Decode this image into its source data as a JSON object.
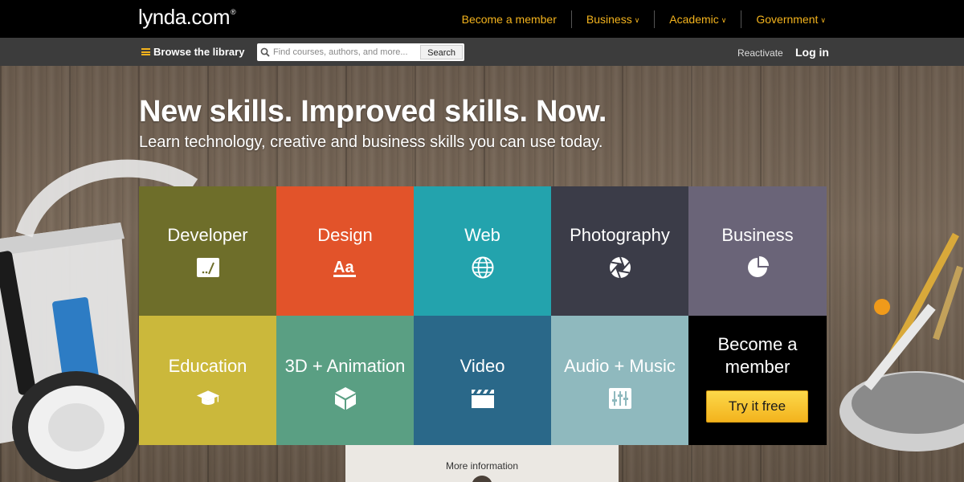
{
  "header": {
    "logo_text": "lynda.com",
    "logo_mark": "®",
    "nav": [
      {
        "label": "Become a member",
        "has_dropdown": false
      },
      {
        "label": "Business",
        "has_dropdown": true
      },
      {
        "label": "Academic",
        "has_dropdown": true
      },
      {
        "label": "Government",
        "has_dropdown": true
      }
    ],
    "accent_color": "#f3b31d"
  },
  "subnav": {
    "browse_label": "Browse the library",
    "search": {
      "placeholder": "Find courses, authors, and more...",
      "value": "",
      "button_label": "Search"
    },
    "reactivate_label": "Reactivate",
    "login_label": "Log in"
  },
  "hero": {
    "headline": "New skills. Improved skills. Now.",
    "subheadline": "Learn technology, creative and business skills you can use today."
  },
  "tiles": [
    {
      "label": "Developer",
      "icon": "code-editor-icon",
      "color": "#6e6e2a"
    },
    {
      "label": "Design",
      "icon": "typography-icon",
      "color": "#e2532a"
    },
    {
      "label": "Web",
      "icon": "globe-icon",
      "color": "#23a3ad"
    },
    {
      "label": "Photography",
      "icon": "aperture-icon",
      "color": "#3b3c48"
    },
    {
      "label": "Business",
      "icon": "pie-chart-icon",
      "color": "#6a6478"
    },
    {
      "label": "Education",
      "icon": "graduation-cap-icon",
      "color": "#cbb83b"
    },
    {
      "label": "3D + Animation",
      "icon": "cube-icon",
      "color": "#5a9f83"
    },
    {
      "label": "Video",
      "icon": "clapperboard-icon",
      "color": "#2a6889"
    },
    {
      "label": "Audio + Music",
      "icon": "mixer-sliders-icon",
      "color": "#8fb9be"
    }
  ],
  "member_tile": {
    "title": "Become a member",
    "cta_label": "Try it free"
  },
  "footer": {
    "more_info_label": "More information"
  }
}
